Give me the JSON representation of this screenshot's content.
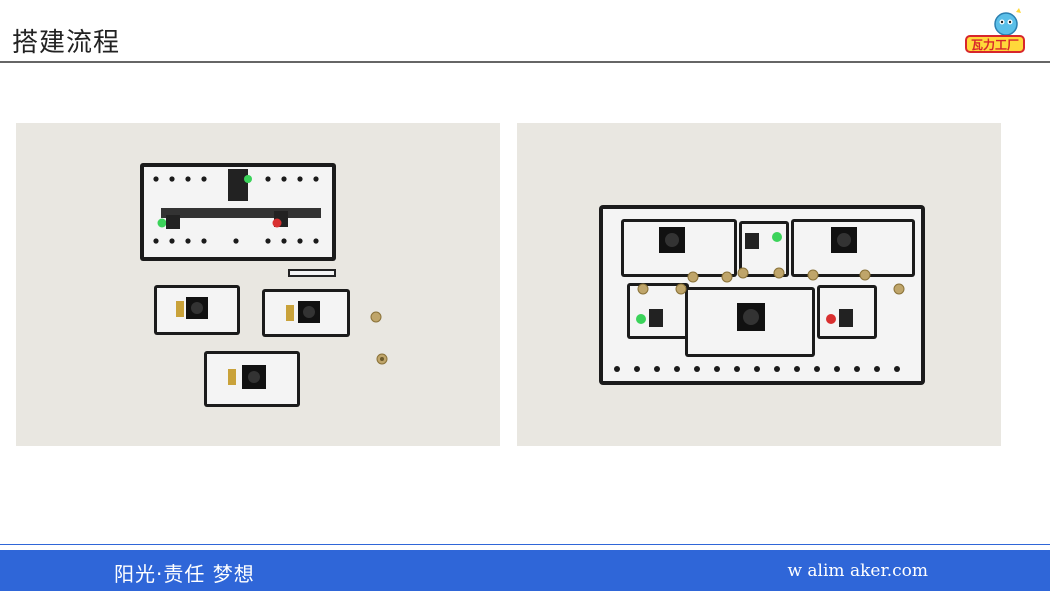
{
  "header": {
    "title": "搭建流程",
    "logo_text": "瓦力工厂"
  },
  "photos": [
    {
      "name": "photo-left",
      "icon": "circuit-modules-photo"
    },
    {
      "name": "photo-right",
      "icon": "assembled-circuit-photo"
    }
  ],
  "footer": {
    "slogan": "阳光·责任 梦想",
    "website": "w alim aker.com"
  },
  "colors": {
    "footer_bg": "#2f66d8",
    "title_line": "#666666",
    "photo_bg": "#e9e7e1"
  }
}
